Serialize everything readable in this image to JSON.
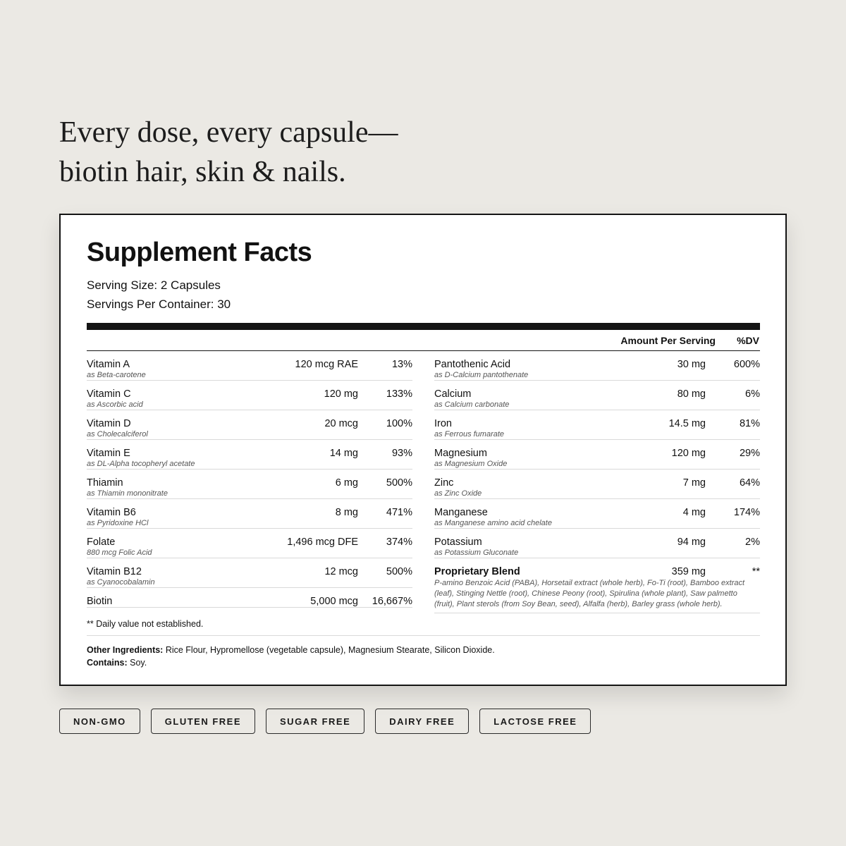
{
  "headline": {
    "line1": "Every dose, every capsule—",
    "line2": "biotin hair, skin & nails."
  },
  "facts": {
    "title": "Supplement Facts",
    "serving_size": "Serving Size: 2 Capsules",
    "servings_per_container": "Servings Per Container: 30",
    "col_amount": "Amount Per Serving",
    "col_dv": "%DV",
    "left_rows": [
      {
        "name": "Vitamin A",
        "sub": "as Beta-carotene",
        "amount": "120 mcg RAE",
        "dv": "13%"
      },
      {
        "name": "Vitamin C",
        "sub": "as Ascorbic acid",
        "amount": "120 mg",
        "dv": "133%"
      },
      {
        "name": "Vitamin D",
        "sub": "as Cholecalciferol",
        "amount": "20 mcg",
        "dv": "100%"
      },
      {
        "name": "Vitamin E",
        "sub": "as DL-Alpha tocopheryl acetate",
        "amount": "14 mg",
        "dv": "93%"
      },
      {
        "name": "Thiamin",
        "sub": "as Thiamin mononitrate",
        "amount": "6 mg",
        "dv": "500%"
      },
      {
        "name": "Vitamin B6",
        "sub": "as Pyridoxine HCl",
        "amount": "8 mg",
        "dv": "471%"
      },
      {
        "name": "Folate",
        "sub": "880 mcg Folic Acid",
        "amount": "1,496 mcg DFE",
        "dv": "374%"
      },
      {
        "name": "Vitamin B12",
        "sub": "as Cyanocobalamin",
        "amount": "12 mcg",
        "dv": "500%"
      },
      {
        "name": "Biotin",
        "sub": "",
        "amount": "5,000 mcg",
        "dv": "16,667%"
      }
    ],
    "right_rows": [
      {
        "name": "Pantothenic Acid",
        "sub": "as D-Calcium pantothenate",
        "amount": "30 mg",
        "dv": "600%"
      },
      {
        "name": "Calcium",
        "sub": "as Calcium carbonate",
        "amount": "80 mg",
        "dv": "6%"
      },
      {
        "name": "Iron",
        "sub": "as Ferrous fumarate",
        "amount": "14.5 mg",
        "dv": "81%"
      },
      {
        "name": "Magnesium",
        "sub": "as Magnesium Oxide",
        "amount": "120 mg",
        "dv": "29%"
      },
      {
        "name": "Zinc",
        "sub": "as Zinc Oxide",
        "amount": "7 mg",
        "dv": "64%"
      },
      {
        "name": "Manganese",
        "sub": "as Manganese amino acid chelate",
        "amount": "4 mg",
        "dv": "174%"
      },
      {
        "name": "Potassium",
        "sub": "as Potassium Gluconate",
        "amount": "94 mg",
        "dv": "2%"
      }
    ],
    "blend": {
      "name": "Proprietary Blend",
      "amount": "359 mg",
      "dv": "**",
      "description": "P-amino Benzoic Acid (PABA), Horsetail extract (whole herb), Fo-Ti (root), Bamboo extract (leaf), Stinging Nettle (root), Chinese Peony (root), Spirulina (whole plant), Saw palmetto (fruit), Plant sterols (from Soy Bean, seed), Alfalfa (herb), Barley grass (whole herb)."
    },
    "footnote": "** Daily value not established.",
    "other_label": "Other Ingredients:",
    "other_text": " Rice Flour, Hypromellose (vegetable capsule), Magnesium Stearate, Silicon Dioxide.",
    "contains_label": "Contains:",
    "contains_text": " Soy."
  },
  "badges": [
    "NON-GMO",
    "GLUTEN FREE",
    "SUGAR FREE",
    "DAIRY FREE",
    "LACTOSE FREE"
  ]
}
